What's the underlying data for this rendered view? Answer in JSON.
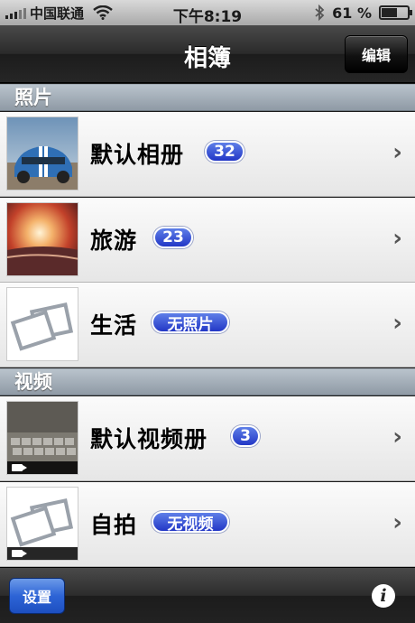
{
  "status_bar": {
    "carrier": "中国联通",
    "time": "下午8:19",
    "battery": "61 %",
    "battery_level": 0.61
  },
  "nav": {
    "title": "相簿",
    "edit_label": "编辑"
  },
  "sections": {
    "photos": {
      "title": "照片",
      "items": [
        {
          "label": "默认相册",
          "count": "32",
          "thumb": "car"
        },
        {
          "label": "旅游",
          "count": "23",
          "thumb": "sunset"
        },
        {
          "label": "生活",
          "count": "无照片",
          "thumb": "empty"
        }
      ]
    },
    "videos": {
      "title": "视频",
      "items": [
        {
          "label": "默认视频册",
          "count": "3",
          "thumb": "keyboard"
        },
        {
          "label": "自拍",
          "count": "无视频",
          "thumb": "empty"
        }
      ]
    }
  },
  "toolbar": {
    "settings_label": "设置",
    "info_label": "i"
  },
  "colors": {
    "badge": "#2a3fcc",
    "settings_button": "#2d64d6",
    "section_header": "#a0abb5"
  }
}
